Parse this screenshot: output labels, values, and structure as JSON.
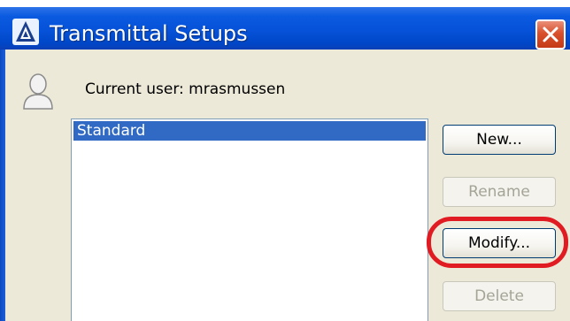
{
  "window": {
    "title": "Transmittal Setups"
  },
  "user": {
    "label": "Current user: mrasmussen"
  },
  "setups": {
    "items": [
      "Standard"
    ],
    "selected": "Standard"
  },
  "buttons": {
    "new": "New...",
    "rename": "Rename",
    "modify": "Modify...",
    "delete": "Delete"
  },
  "colors": {
    "titlebar": "#0652d8",
    "selection": "#316ac5",
    "highlight_ring": "#e11b22",
    "dialog_bg": "#ece9d8"
  },
  "icons": {
    "app": "autocad-app-icon",
    "user": "user-silhouette-icon",
    "close": "close-icon"
  }
}
